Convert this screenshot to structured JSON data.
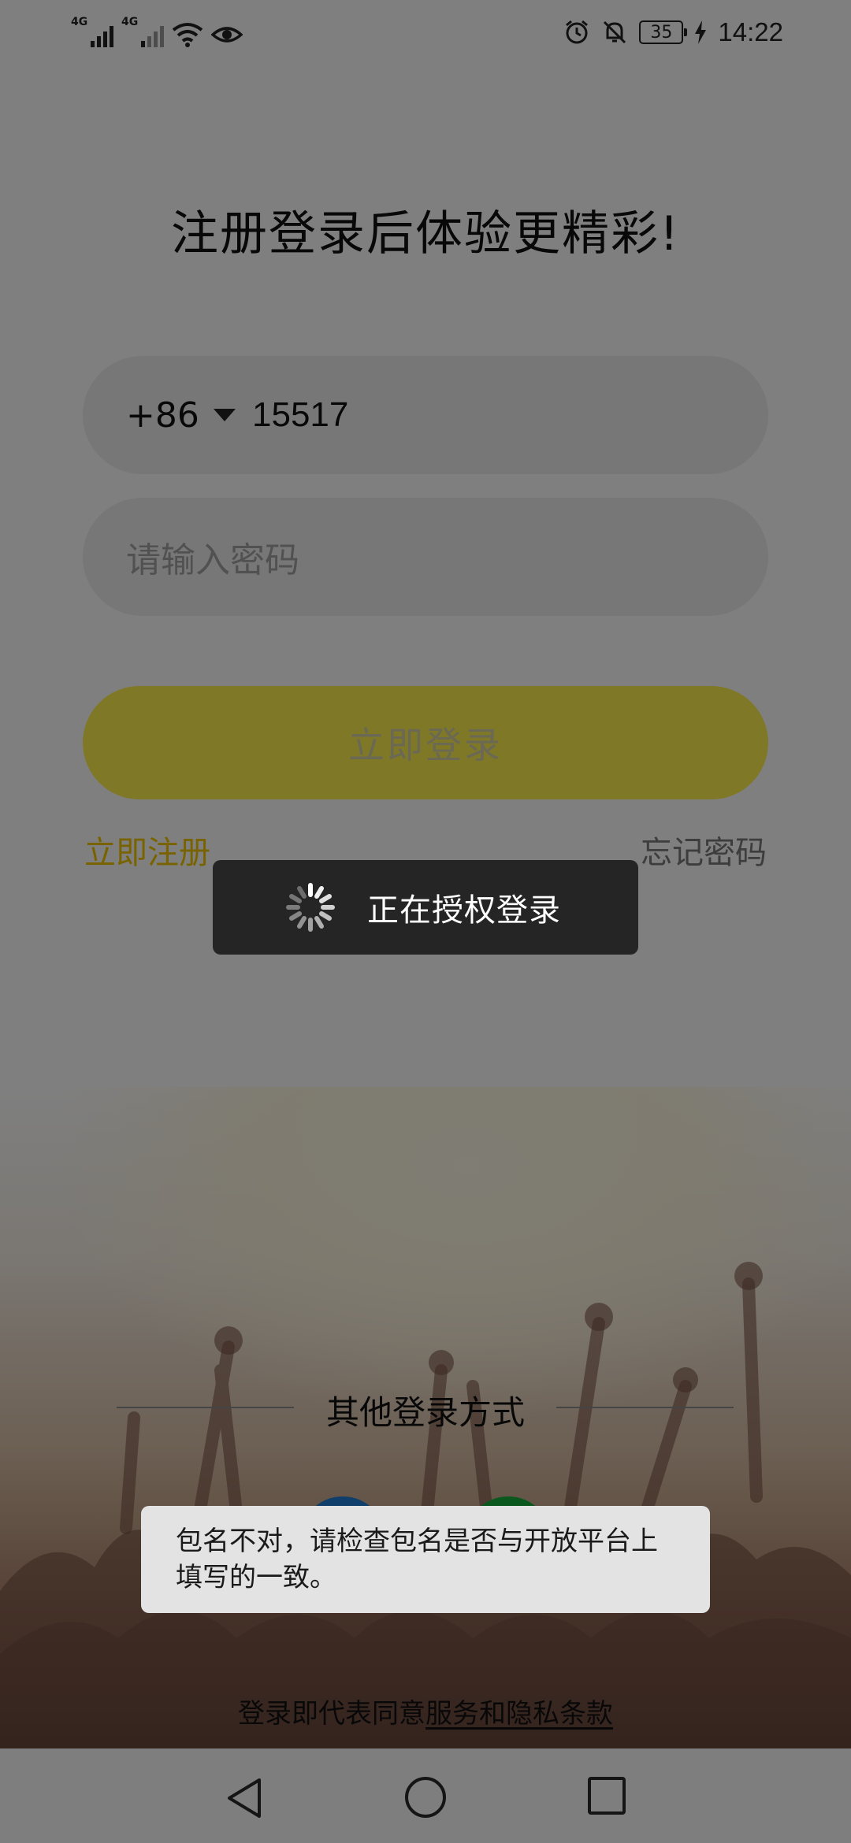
{
  "status_bar": {
    "sim1": "4G",
    "sim2": "4G",
    "battery": "35",
    "time": "14:22"
  },
  "headline": "注册登录后体验更精彩!",
  "phone": {
    "country_code": "+86",
    "value": "15517"
  },
  "password": {
    "placeholder": "请输入密码"
  },
  "login_button": "立即登录",
  "register_link": "立即注册",
  "forgot_link": "忘记密码",
  "other_login": "其他登录方式",
  "terms": {
    "prefix": "登录即代表同意",
    "link": "服务和隐私条款"
  },
  "loading": {
    "text": "正在授权登录"
  },
  "toast": {
    "message": "包名不对，请检查包名是否与开放平台上填写的一致。"
  },
  "colors": {
    "accent": "#fef04f",
    "register": "#f1c700",
    "wechat": "#14b13a",
    "qq": "#1f7fd4"
  },
  "icons": [
    "signal-icon",
    "wifi-icon",
    "eye-icon",
    "alarm-icon",
    "bell-off-icon",
    "battery-icon",
    "charging-icon",
    "dropdown-icon",
    "spinner-icon",
    "back-icon",
    "home-icon",
    "recent-apps-icon"
  ]
}
